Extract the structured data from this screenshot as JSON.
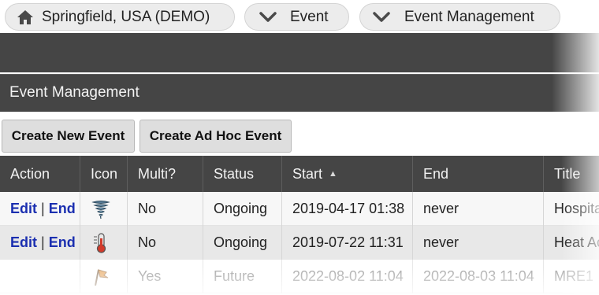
{
  "breadcrumb": {
    "items": [
      {
        "label": "Springfield, USA (DEMO)",
        "icon": "home-icon"
      },
      {
        "label": "Event",
        "icon": "chevron-down-icon"
      },
      {
        "label": "Event Management",
        "icon": "chevron-down-icon"
      }
    ]
  },
  "page": {
    "title": "Event Management"
  },
  "toolbar": {
    "create_new_label": "Create New Event",
    "create_adhoc_label": "Create Ad Hoc Event"
  },
  "table": {
    "columns": [
      "Action",
      "Icon",
      "Multi?",
      "Status",
      "Start",
      "End",
      "Title"
    ],
    "sorted_column": "Start",
    "sort_direction": "ascending",
    "rows": [
      {
        "edit": "Edit",
        "separator": "|",
        "end_action": "End",
        "icon": "tornado-icon",
        "multi": "No",
        "status": "Ongoing",
        "start": "2019-04-17 01:38",
        "end": "never",
        "title": "Hospita"
      },
      {
        "edit": "Edit",
        "separator": "|",
        "end_action": "End",
        "icon": "thermometer-icon",
        "multi": "No",
        "status": "Ongoing",
        "start": "2019-07-22 11:31",
        "end": "never",
        "title": "Heat Ac"
      },
      {
        "edit": "",
        "separator": "",
        "end_action": "",
        "icon": "flag-icon",
        "multi": "Yes",
        "status": "Future",
        "start": "2022-08-02 11:04",
        "end": "2022-08-03 11:04",
        "title": "MRE1"
      }
    ]
  },
  "colors": {
    "header_bg": "#454545",
    "link": "#1b2fb0",
    "button_bg": "#dedede"
  }
}
